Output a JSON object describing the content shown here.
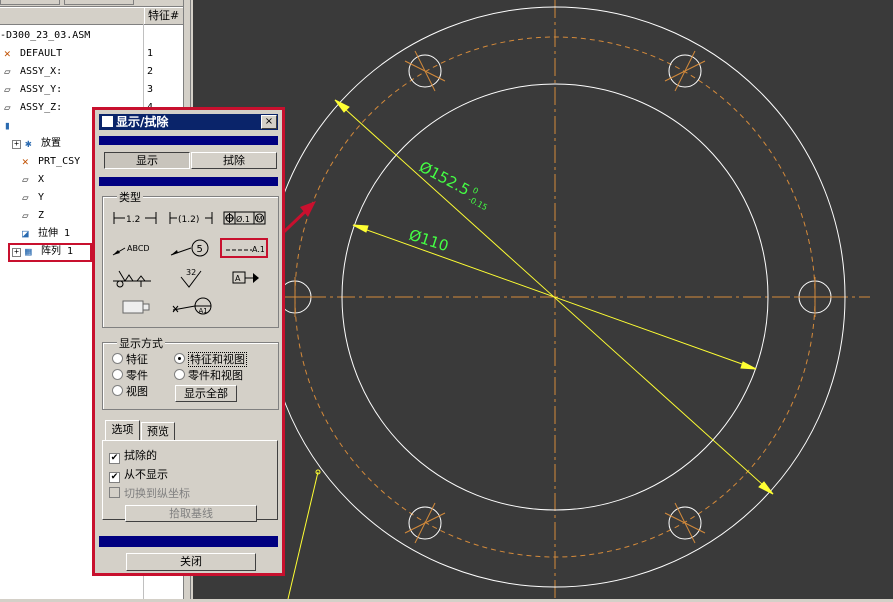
{
  "tree": {
    "column_header": "特征#",
    "items": [
      {
        "label": "-D300_23_03.ASM",
        "num": "",
        "icon": "assembly-icon"
      },
      {
        "label": "DEFAULT",
        "num": "1",
        "icon": "csys-icon"
      },
      {
        "label": "ASSY_X:",
        "num": "2",
        "icon": "datum-plane-icon"
      },
      {
        "label": "ASSY_Y:",
        "num": "3",
        "icon": "datum-plane-icon"
      },
      {
        "label": "ASSY_Z:",
        "num": "4",
        "icon": "datum-plane-icon"
      },
      {
        "label": "",
        "num": "",
        "icon": "part-icon"
      },
      {
        "label": "放置",
        "num": "",
        "icon": "placement-icon"
      },
      {
        "label": "PRT_CSY",
        "num": "",
        "icon": "csys-icon"
      },
      {
        "label": "X",
        "num": "",
        "icon": "datum-plane-icon"
      },
      {
        "label": "Y",
        "num": "",
        "icon": "datum-plane-icon"
      },
      {
        "label": "Z",
        "num": "",
        "icon": "datum-plane-icon"
      },
      {
        "label": "拉伸 1",
        "num": "",
        "icon": "extrude-icon"
      },
      {
        "label": "阵列 1",
        "num": "",
        "icon": "pattern-icon"
      }
    ]
  },
  "dialog": {
    "title": "显示/拭除",
    "close_glyph": "×",
    "tabs_top": {
      "show": "显示",
      "erase": "拭除"
    },
    "type_group_label": "类型",
    "type_icons": [
      {
        "name": "dimension-icon",
        "text": "1.2"
      },
      {
        "name": "reference-dimension-icon",
        "text": "(1.2)"
      },
      {
        "name": "geometric-tolerance-icon",
        "text": "⊕Ø.1Ⓜ"
      },
      {
        "name": "note-icon",
        "text": "ABCD"
      },
      {
        "name": "balloon-icon",
        "text": "5"
      },
      {
        "name": "axis-icon",
        "text": "A_1"
      },
      {
        "name": "symbol-icon",
        "text": ""
      },
      {
        "name": "surface-finish-icon",
        "text": "32"
      },
      {
        "name": "datum-plane-tag-icon",
        "text": "A"
      },
      {
        "name": "cosmetic-feature-icon",
        "text": ""
      },
      {
        "name": "datum-target-icon",
        "text": "A1"
      }
    ],
    "display_mode_label": "显示方式",
    "display_modes": [
      {
        "label": "特征",
        "selected": false
      },
      {
        "label": "特征和视图",
        "selected": true
      },
      {
        "label": "零件",
        "selected": false
      },
      {
        "label": "零件和视图",
        "selected": false
      },
      {
        "label": "视图",
        "selected": false
      }
    ],
    "show_all_button": "显示全部",
    "lower_tabs": {
      "options": "选项",
      "preview": "预览"
    },
    "options": [
      {
        "label": "拭除的",
        "checked": true,
        "enabled": true
      },
      {
        "label": "从不显示",
        "checked": true,
        "enabled": true
      },
      {
        "label": "切换到纵坐标",
        "checked": false,
        "enabled": false
      }
    ],
    "pick_baseline_button": "拾取基线",
    "close_button": "关闭"
  },
  "drawing": {
    "dim_outer": "Ø152.5",
    "dim_outer_tol_upper": "0",
    "dim_outer_tol_lower": "-0.15",
    "dim_inner": "Ø110",
    "colors": {
      "geometry": "#ffffff",
      "center": "#d48a3a",
      "dimension": "#ffff33",
      "dim_text": "#44ff44",
      "highlight": "#c8102e"
    }
  }
}
